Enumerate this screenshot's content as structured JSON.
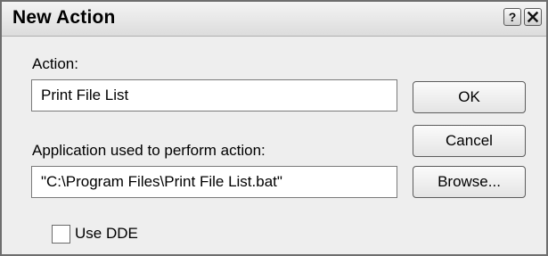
{
  "window": {
    "title": "New Action",
    "help_icon": "question-mark-icon",
    "close_icon": "close-x-icon"
  },
  "action": {
    "label": "Action:",
    "value": "Print File List"
  },
  "application": {
    "label": "Application used to perform action:",
    "value": "\"C:\\Program Files\\Print File List.bat\""
  },
  "buttons": {
    "ok": "OK",
    "cancel": "Cancel",
    "browse": "Browse..."
  },
  "dde": {
    "label": "Use DDE",
    "checked": false
  }
}
